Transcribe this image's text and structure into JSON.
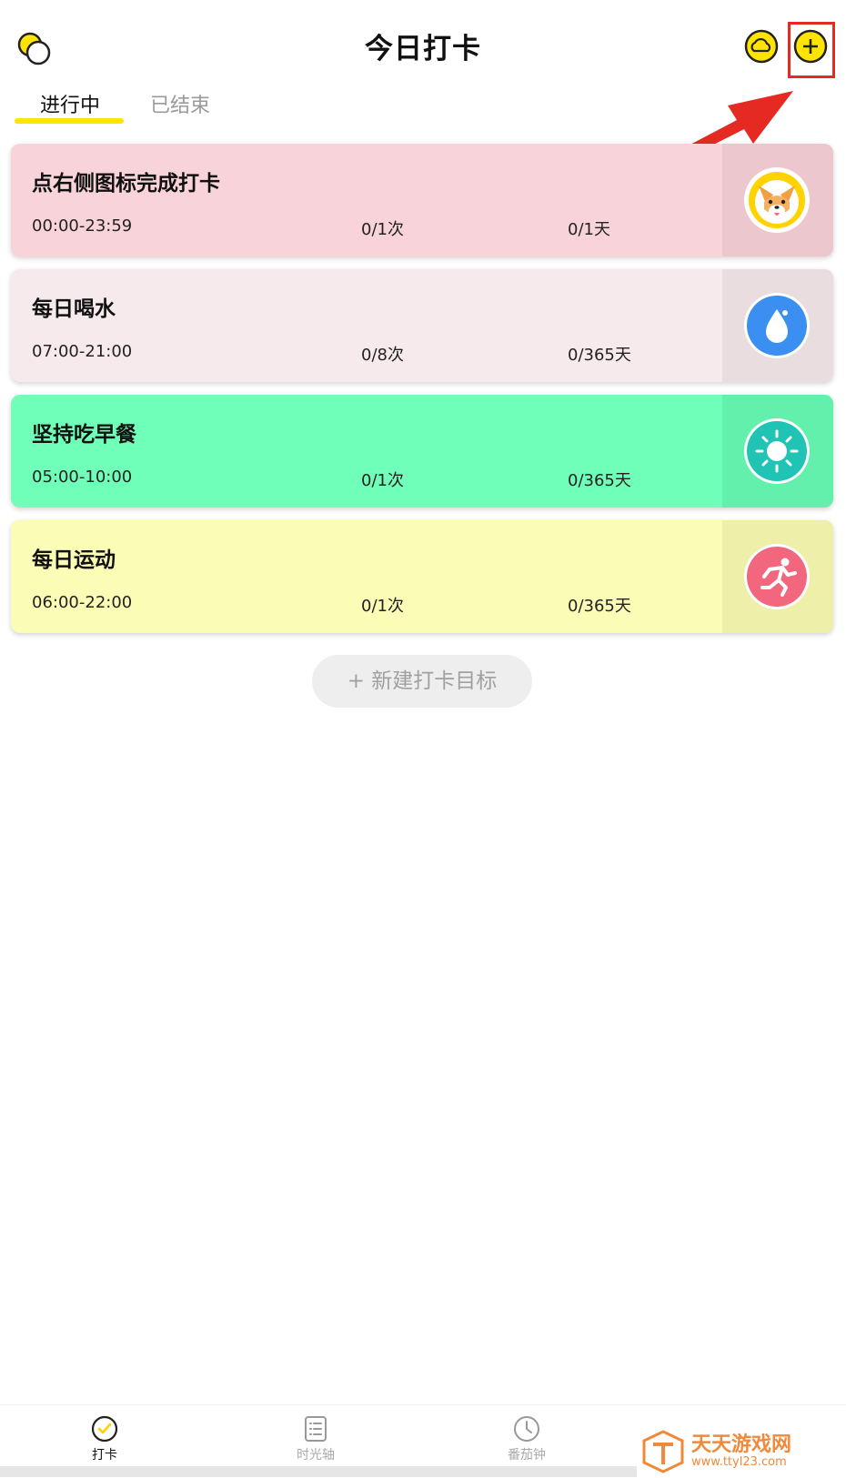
{
  "header": {
    "title": "今日打卡"
  },
  "tabs": [
    {
      "label": "进行中"
    },
    {
      "label": "已结束"
    }
  ],
  "cards": [
    {
      "title": "点右侧图标完成打卡",
      "time": "00:00-23:59",
      "count": "0/1次",
      "days": "0/1天",
      "bg": "#f8d4da",
      "side_bg": "#ecc8ce",
      "icon": "corgi-icon"
    },
    {
      "title": "每日喝水",
      "time": "07:00-21:00",
      "count": "0/8次",
      "days": "0/365天",
      "bg": "#f6eaed",
      "side_bg": "#e9dde0",
      "icon": "water-drop-icon"
    },
    {
      "title": "坚持吃早餐",
      "time": "05:00-10:00",
      "count": "0/1次",
      "days": "0/365天",
      "bg": "#6fffb9",
      "side_bg": "#62f0ac",
      "icon": "sun-icon"
    },
    {
      "title": "每日运动",
      "time": "06:00-22:00",
      "count": "0/1次",
      "days": "0/365天",
      "bg": "#fbfcb5",
      "side_bg": "#eeefa8",
      "icon": "runner-icon"
    }
  ],
  "new_goal": {
    "label": "+ 新建打卡目标"
  },
  "bottom_nav": [
    {
      "label": "打卡",
      "icon": "check-circle-icon"
    },
    {
      "label": "时光轴",
      "icon": "list-icon"
    },
    {
      "label": "番茄钟",
      "icon": "clock-icon"
    }
  ],
  "watermark": {
    "title": "天天游戏网",
    "url": "www.ttyl23.com"
  },
  "colors": {
    "accent": "#ffe400",
    "highlight": "#e42a22"
  }
}
